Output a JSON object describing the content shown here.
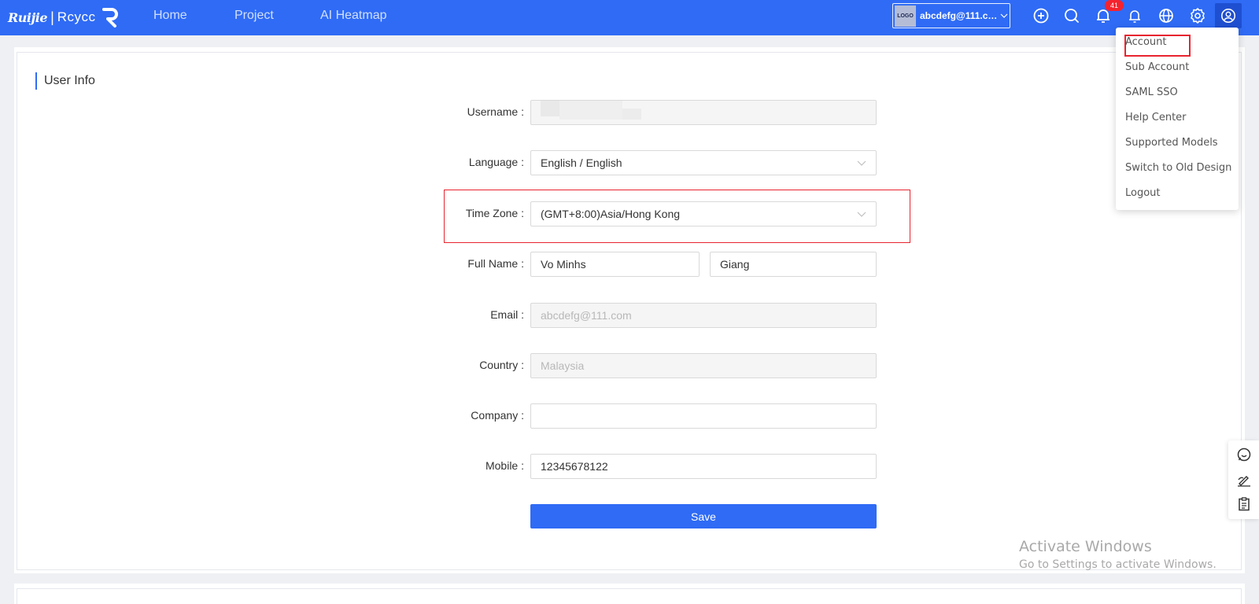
{
  "brand": {
    "ruijie": "Ruijie",
    "separator": "|",
    "reyee": "Rcycc"
  },
  "nav": {
    "home": "Home",
    "project": "Project",
    "heatmap": "AI Heatmap"
  },
  "account": {
    "logo_text": "LOGO",
    "email": "abcdefg@111.com"
  },
  "notifications": {
    "count": "41"
  },
  "colors": {
    "primary": "#2f6bf5",
    "highlight": "#e8242f",
    "badge": "#f5222d"
  },
  "icons": [
    "add-icon",
    "search-icon",
    "bell-icon",
    "bell-outline-icon",
    "globe-icon",
    "gear-icon",
    "user-icon",
    "chat-icon",
    "edit-icon",
    "clipboard-icon"
  ],
  "section": {
    "title": "User Info"
  },
  "form": {
    "username_label": "Username",
    "username_value": "",
    "language_label": "Language",
    "language_value": "English / English",
    "timezone_label": "Time Zone",
    "timezone_value": "(GMT+8:00)Asia/Hong Kong",
    "fullname_label": "Full Name",
    "first_name": "Vo Minhs",
    "last_name": "Giang",
    "email_label": "Email",
    "email_value": "abcdefg@111.com",
    "country_label": "Country",
    "country_value": "Malaysia",
    "company_label": "Company",
    "company_value": "",
    "mobile_label": "Mobile",
    "mobile_value": "12345678122",
    "save_label": "Save"
  },
  "menu": {
    "items": [
      "Account",
      "Sub Account",
      "SAML SSO",
      "Help Center",
      "Supported Models",
      "Switch to Old Design",
      "Logout"
    ]
  },
  "watermark": {
    "line1": "Activate Windows",
    "line2": "Go to Settings to activate Windows."
  }
}
